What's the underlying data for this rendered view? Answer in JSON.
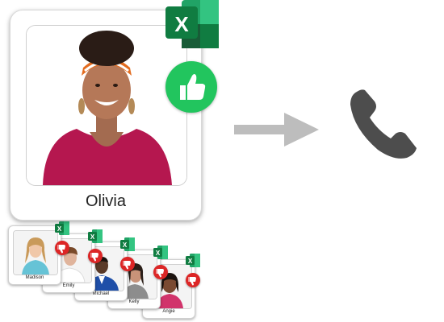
{
  "main_person": {
    "name": "Olivia",
    "icon": "excel-icon",
    "status_icon": "thumbs-up-icon",
    "status_color": "#22c55e"
  },
  "flow": {
    "arrow_icon": "arrow-right-icon",
    "arrow_color": "#bdbdbd",
    "destination_icon": "phone-icon",
    "destination_color": "#4d4d4d"
  },
  "candidates": [
    {
      "name": "Madison",
      "status_icon": "thumbs-down-icon"
    },
    {
      "name": "Emily",
      "status_icon": "thumbs-down-icon"
    },
    {
      "name": "Michael",
      "status_icon": "thumbs-down-icon"
    },
    {
      "name": "Kelly",
      "status_icon": "thumbs-down-icon"
    },
    {
      "name": "Angie",
      "status_icon": "thumbs-down-icon"
    }
  ],
  "colors": {
    "excel_dark": "#107c41",
    "excel_light": "#21a366",
    "reject": "#dc2626"
  }
}
